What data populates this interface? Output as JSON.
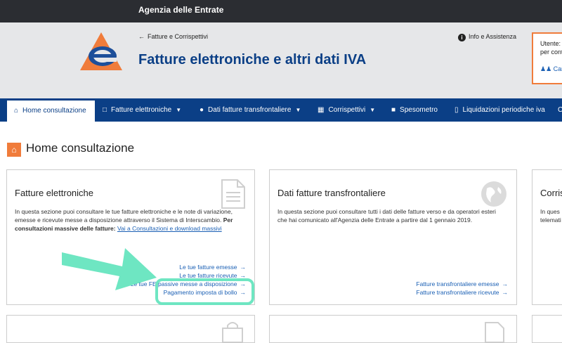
{
  "topbar": {
    "agency": "Agenzia delle Entrate"
  },
  "header": {
    "breadcrumb": "Fatture e Corrispettivi",
    "title": "Fatture elettroniche e altri dati IVA",
    "info": "Info e Assistenza",
    "user_label": "Utente:",
    "user_sub": "per cont",
    "change_label": "Cam"
  },
  "nav": {
    "home": "Home consultazione",
    "fatture": "Fatture elettroniche",
    "transfrontaliere": "Dati fatture transfrontaliere",
    "corrispettivi": "Corrispettivi",
    "spesometro": "Spesometro",
    "liquidazioni": "Liquidazioni periodiche iva",
    "more": "C"
  },
  "page": {
    "title": "Home consultazione"
  },
  "cards": {
    "fatture": {
      "title": "Fatture elettroniche",
      "desc_line1": "In questa sezione puoi consultare le tue fatture elettroniche e le note di variazione,",
      "desc_line2": "emesse e ricevute messe a disposizione attraverso il Sistema di Interscambio.",
      "desc_bold": "Per consultazioni massive delle fatture:",
      "desc_link": "Vai a Consultazioni e download massivi",
      "link1": "Le tue fatture emesse",
      "link2": "Le tue fatture ricevute",
      "link3": "Le tue FE passive messe a disposizione",
      "link4": "Pagamento imposta di bollo"
    },
    "transfrontaliere": {
      "title": "Dati fatture transfrontaliere",
      "desc_line1": "In questa sezione puoi consultare tutti i dati delle fatture verso e da operatori esteri",
      "desc_line2": "che hai comunicato all'Agenzia delle Entrate a partire dal 1 gennaio 2019.",
      "link1": "Fatture transfrontaliere emesse",
      "link2": "Fatture transfrontaliere ricevute"
    },
    "corrispettivi": {
      "title": "Corris",
      "desc_line1": "In ques",
      "desc_line2": "telemati"
    }
  },
  "colors": {
    "brand": "#0b3f86",
    "accent": "#f07c3b",
    "highlight": "#6ee6c2",
    "link": "#1a5fb4"
  }
}
